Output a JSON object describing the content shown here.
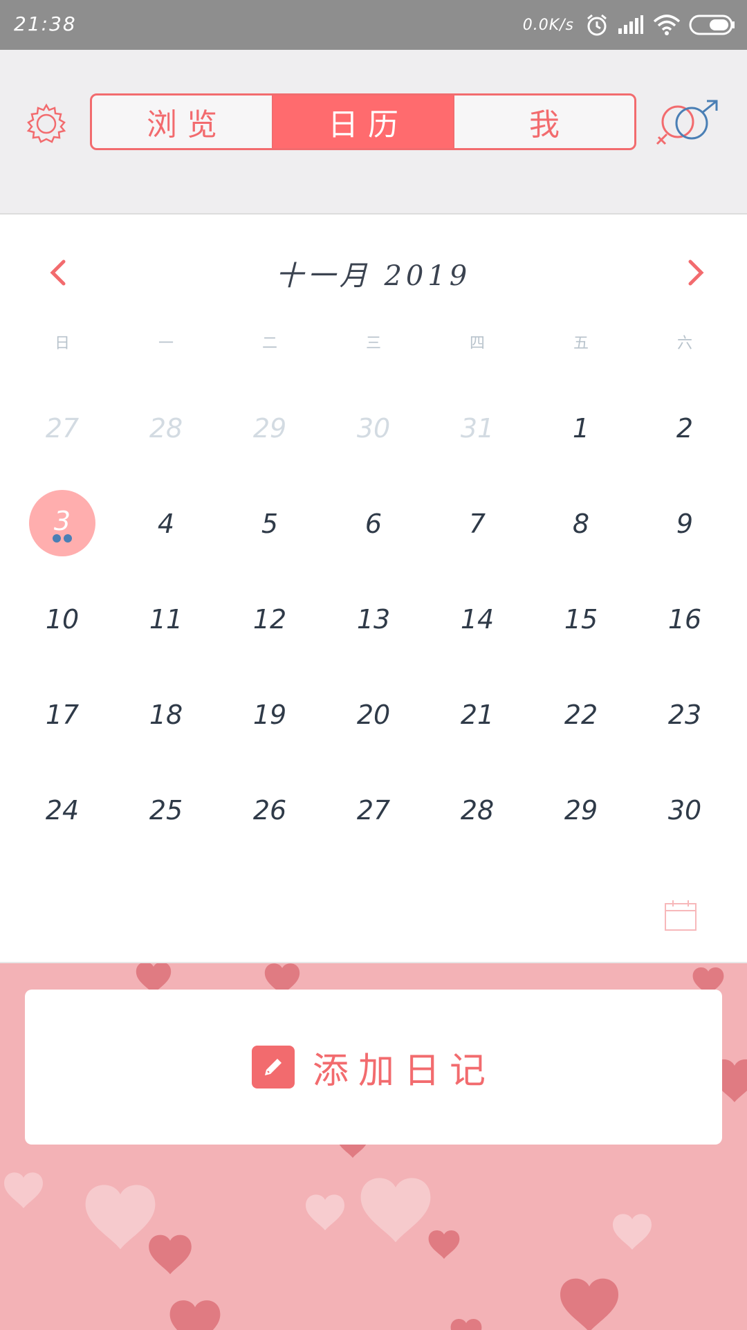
{
  "status_bar": {
    "time": "21:38",
    "net_speed": "0.0K/s",
    "icons": [
      "alarm-icon",
      "signal-icon",
      "wifi-icon",
      "battery-icon"
    ]
  },
  "header": {
    "tabs": [
      {
        "label": "浏览",
        "active": false
      },
      {
        "label": "日历",
        "active": true
      },
      {
        "label": "我",
        "active": false
      }
    ],
    "left_icon": "gear-icon",
    "right_icon": "gender-icon"
  },
  "calendar": {
    "title": "十一月 2019",
    "weekdays": [
      "日",
      "一",
      "二",
      "三",
      "四",
      "五",
      "六"
    ],
    "days": [
      {
        "d": "27",
        "muted": true
      },
      {
        "d": "28",
        "muted": true
      },
      {
        "d": "29",
        "muted": true
      },
      {
        "d": "30",
        "muted": true
      },
      {
        "d": "31",
        "muted": true
      },
      {
        "d": "1"
      },
      {
        "d": "2"
      },
      {
        "d": "3",
        "today": true,
        "entries": 2
      },
      {
        "d": "4"
      },
      {
        "d": "5"
      },
      {
        "d": "6"
      },
      {
        "d": "7"
      },
      {
        "d": "8"
      },
      {
        "d": "9"
      },
      {
        "d": "10"
      },
      {
        "d": "11"
      },
      {
        "d": "12"
      },
      {
        "d": "13"
      },
      {
        "d": "14"
      },
      {
        "d": "15"
      },
      {
        "d": "16"
      },
      {
        "d": "17"
      },
      {
        "d": "18"
      },
      {
        "d": "19"
      },
      {
        "d": "20"
      },
      {
        "d": "21"
      },
      {
        "d": "22"
      },
      {
        "d": "23"
      },
      {
        "d": "24"
      },
      {
        "d": "25"
      },
      {
        "d": "26"
      },
      {
        "d": "27"
      },
      {
        "d": "28"
      },
      {
        "d": "29"
      },
      {
        "d": "30"
      }
    ]
  },
  "add_diary": {
    "label": "添加日记",
    "icon": "pencil-icon"
  },
  "colors": {
    "accent": "#f26b6e",
    "today_circle": "#ffaeae",
    "entry_dot": "#4a7fb5",
    "bottom_bg": "#f3b2b6"
  }
}
